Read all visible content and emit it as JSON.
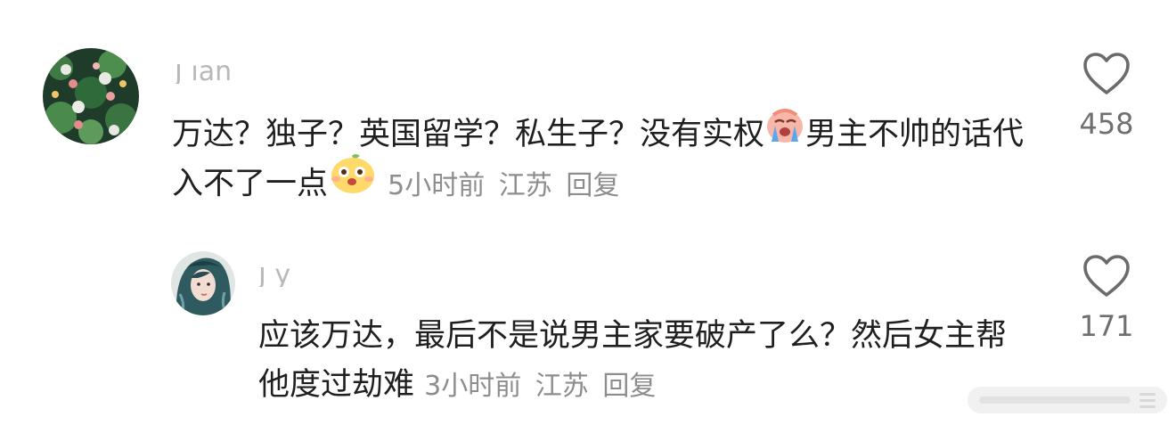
{
  "comments": [
    {
      "username": "J        ian",
      "avatar": "avatar-cats-in-plants",
      "text_parts": [
        "万达？独子？英国留学？私生子？没有实权",
        "男主不帅的话代入不了一点"
      ],
      "emojis": [
        "crying-emoji",
        "dog-face-emoji"
      ],
      "time": "5小时前",
      "location": "江苏",
      "reply_label": "回复",
      "likes": "458"
    },
    {
      "username": "J     y",
      "avatar": "avatar-girl-portrait",
      "text": "应该万达，最后不是说男主家要破产了么？然后女主帮他度过劫难",
      "time": "3小时前",
      "location": "江苏",
      "reply_label": "回复",
      "likes": "171"
    }
  ],
  "colors": {
    "text": "#1f1f1f",
    "meta": "#8d8d8d",
    "username": "#b8b8b8",
    "like_count": "#6f6f6f"
  },
  "icons": {
    "like": "heart-outline-icon"
  }
}
